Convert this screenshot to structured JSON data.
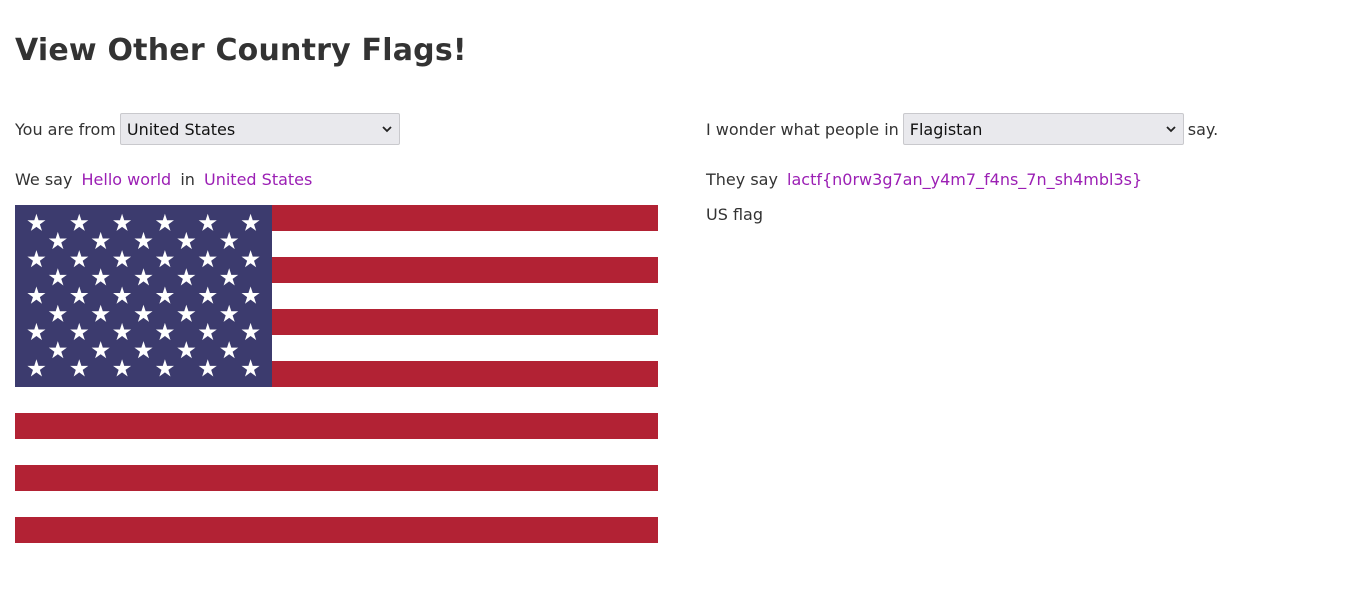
{
  "page": {
    "title": "View Other Country Flags!"
  },
  "left": {
    "label": "You are from",
    "select_value": "United States",
    "say_prefix": "We say",
    "greeting": "Hello world",
    "in_word": "in",
    "country": "United States",
    "flag": {
      "alt": "US flag",
      "icon": "us-flag",
      "colors": {
        "red": "#b22234",
        "blue": "#3c3b6e",
        "white": "#ffffff"
      }
    }
  },
  "right": {
    "label_before": "I wonder what people in",
    "select_value": "Flagistan",
    "label_after": "say.",
    "they_say": "They say",
    "phrase": "lactf{n0rw3g7an_y4m7_f4ns_7n_sh4mbl3s}",
    "broken_image_alt": "US flag"
  },
  "colors": {
    "link": "#9b1fb4",
    "text": "#333333",
    "select_bg": "#e9e9ed"
  }
}
